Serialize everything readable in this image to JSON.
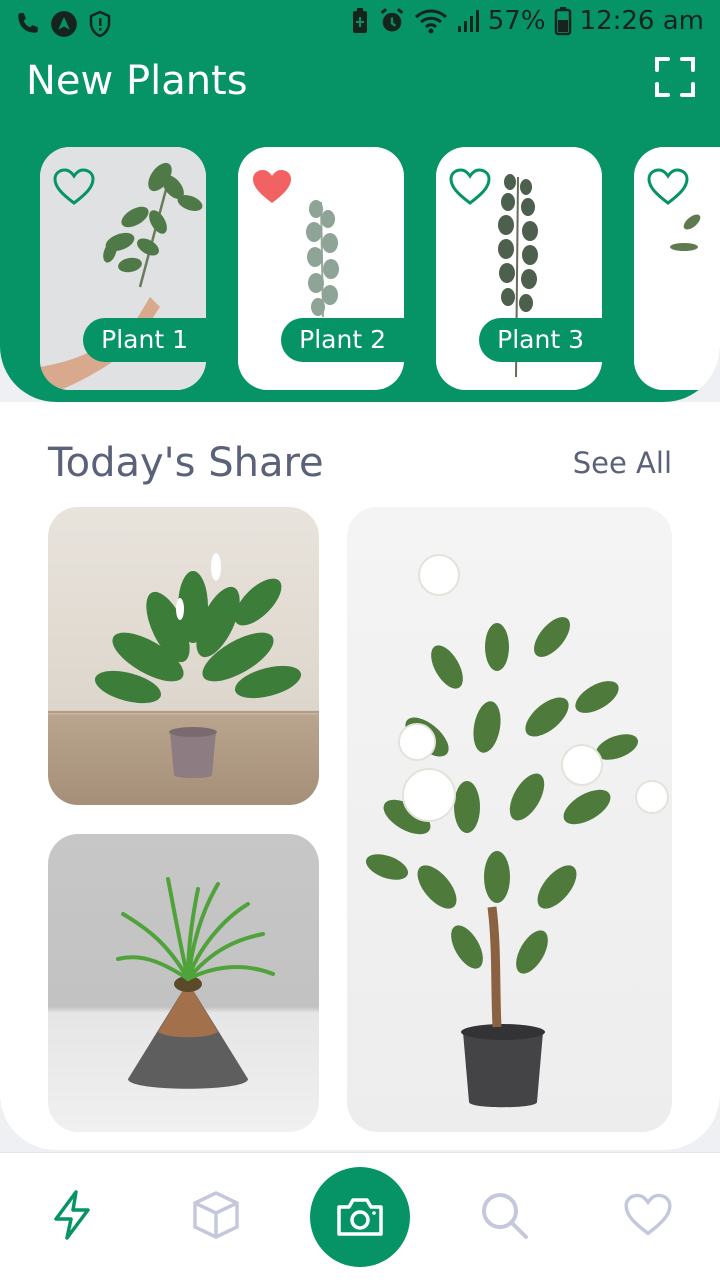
{
  "status_bar": {
    "battery_percent": "57%",
    "time": "12:26 am",
    "left_icons": [
      "phone-icon",
      "nav-arrow-icon",
      "shield-icon"
    ],
    "right_icons": [
      "battery-saver-icon",
      "alarm-icon",
      "wifi-icon",
      "signal-icon",
      "battery-icon"
    ]
  },
  "header": {
    "title": "New Plants",
    "scan_icon": "scan-frame-icon"
  },
  "new_plants": [
    {
      "label": "Plant 1",
      "favorited": false
    },
    {
      "label": "Plant 2",
      "favorited": true
    },
    {
      "label": "Plant 3",
      "favorited": false
    },
    {
      "label": "",
      "favorited": false
    }
  ],
  "todays_share": {
    "title": "Today's Share",
    "see_all": "See All"
  },
  "bottom_nav": {
    "items": [
      "bolt-icon",
      "cube-icon",
      "camera-icon",
      "search-icon",
      "heart-icon"
    ],
    "active": "bolt-icon"
  },
  "colors": {
    "brand_green": "#069466",
    "heart_red": "#f26262",
    "text_slate": "#5a6178",
    "inactive_icon": "#c5c8dc"
  }
}
